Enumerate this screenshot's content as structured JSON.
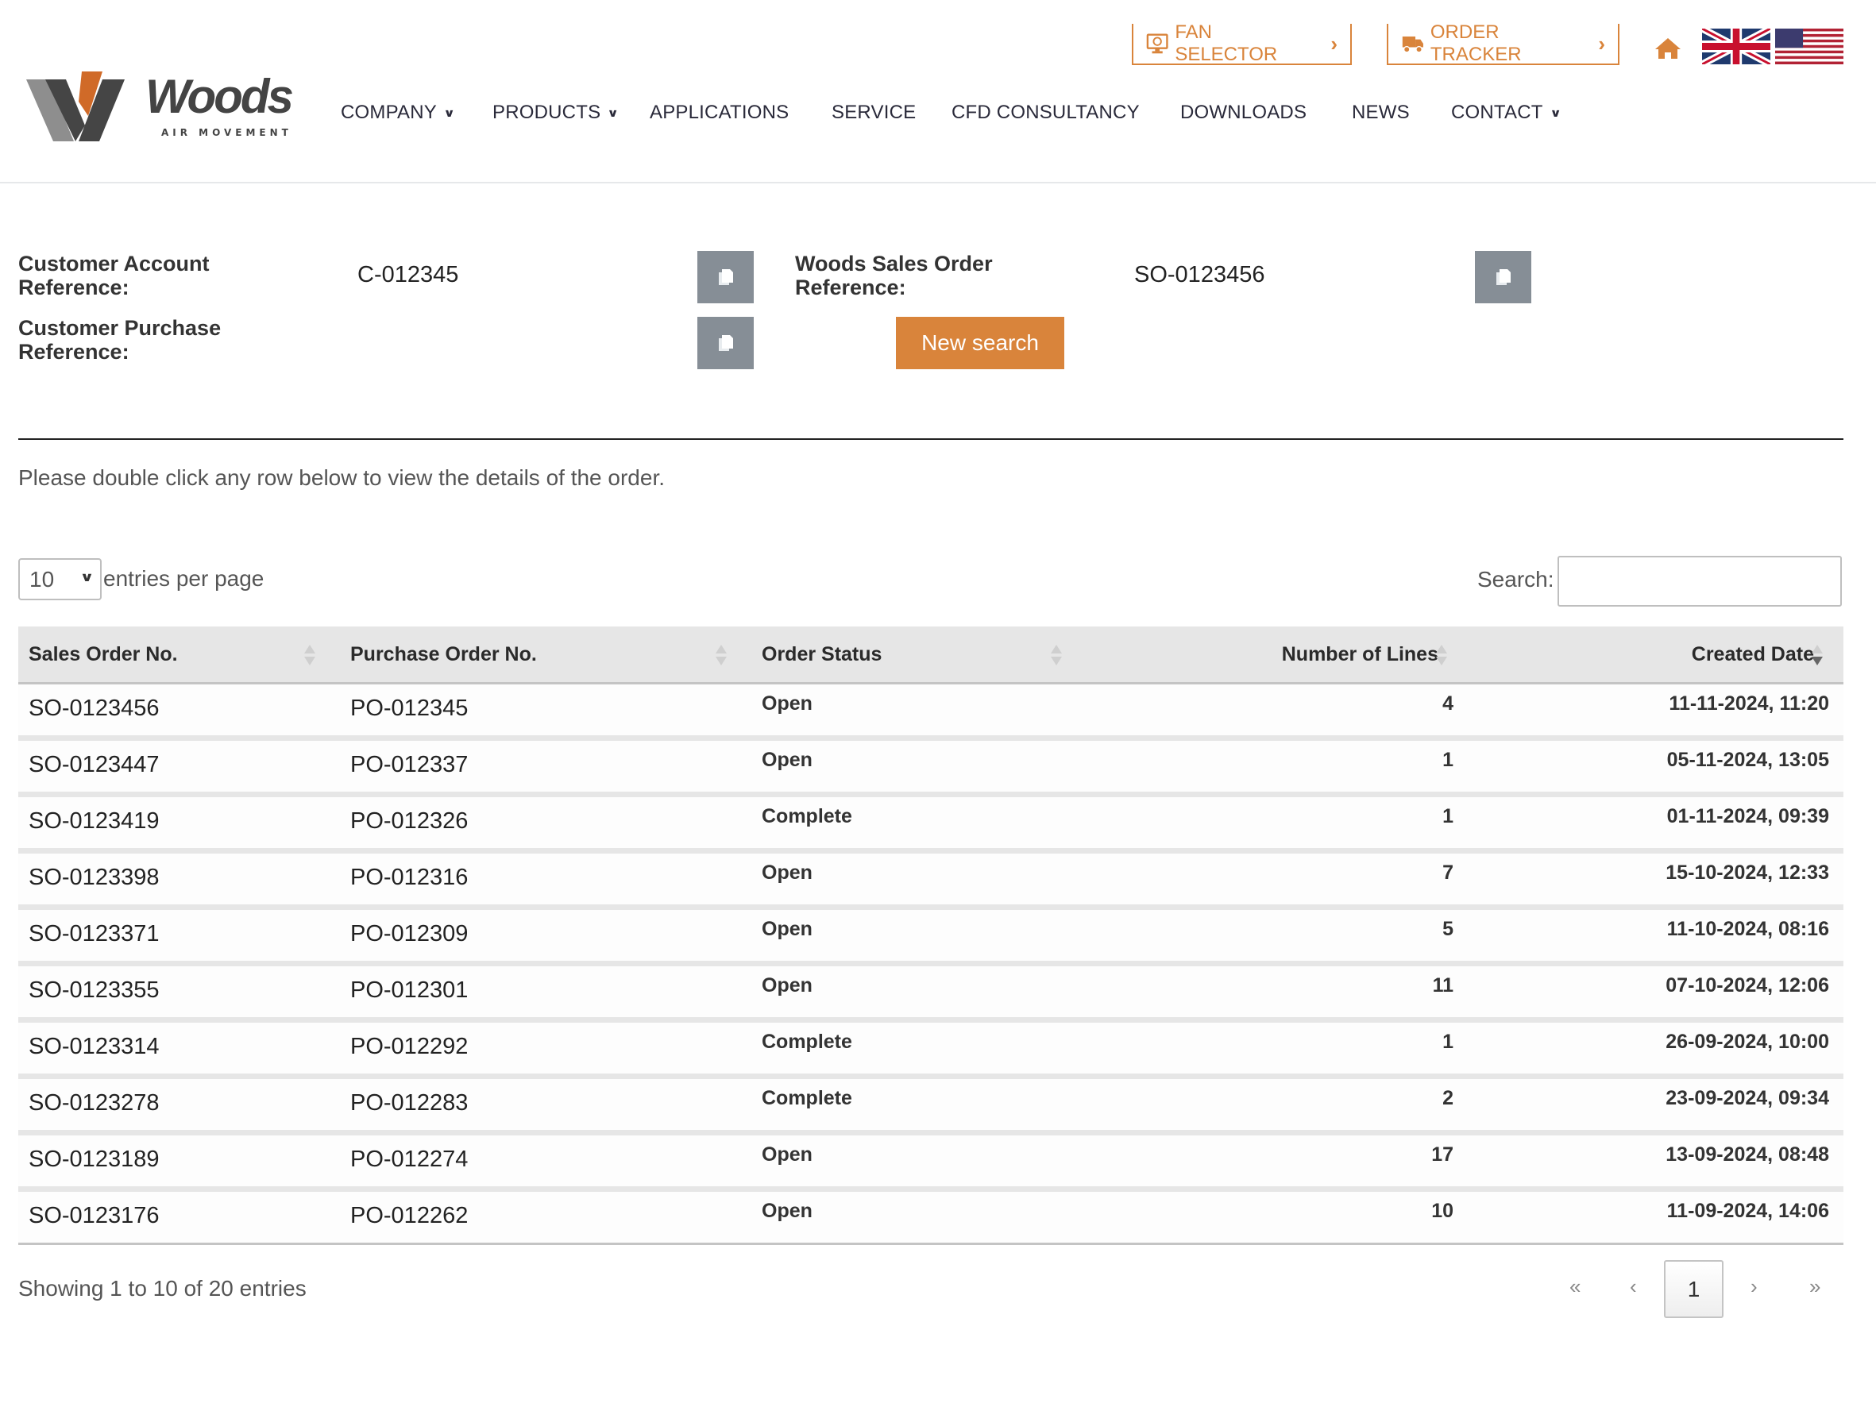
{
  "header": {
    "logo": {
      "name": "Woods",
      "tagline": "AIR MOVEMENT"
    },
    "top_buttons": [
      {
        "label": "FAN SELECTOR",
        "icon": "monitor-fan-icon"
      },
      {
        "label": "ORDER TRACKER",
        "icon": "delivery-truck-icon"
      }
    ],
    "home_icon": "home-icon",
    "languages": [
      "English (UK)",
      "English (US)"
    ],
    "nav": [
      {
        "label": "COMPANY",
        "has_dropdown": true
      },
      {
        "label": "PRODUCTS",
        "has_dropdown": true
      },
      {
        "label": "APPLICATIONS",
        "has_dropdown": false
      },
      {
        "label": "SERVICE",
        "has_dropdown": false
      },
      {
        "label": "CFD CONSULTANCY",
        "has_dropdown": false
      },
      {
        "label": "DOWNLOADS",
        "has_dropdown": false
      },
      {
        "label": "NEWS",
        "has_dropdown": false
      },
      {
        "label": "CONTACT",
        "has_dropdown": true
      }
    ],
    "caret": "⌄",
    "chevron": "›"
  },
  "references": {
    "customer_account": {
      "label_line1": "Customer Account",
      "label_line2": "Reference:",
      "value": "C-012345"
    },
    "customer_purchase": {
      "label_line1": "Customer Purchase",
      "label_line2": "Reference:",
      "value": ""
    },
    "woods_sales_order": {
      "label_line1": "Woods Sales Order",
      "label_line2": "Reference:",
      "value": "SO-0123456"
    },
    "new_search_label": "New search"
  },
  "instruction": "Please double click any row below to view the details of the order.",
  "table_controls": {
    "page_size": "10",
    "entries_label": "entries per page",
    "search_label": "Search:",
    "search_value": ""
  },
  "table": {
    "columns": [
      {
        "label": "Sales Order No.",
        "sort": "none"
      },
      {
        "label": "Purchase Order No.",
        "sort": "none"
      },
      {
        "label": "Order Status",
        "sort": "none"
      },
      {
        "label": "Number of Lines",
        "sort": "none"
      },
      {
        "label": "Created Date",
        "sort": "desc"
      }
    ],
    "rows": [
      {
        "sales_order": "SO-0123456",
        "purchase_order": "PO-012345",
        "status": "Open",
        "lines": "4",
        "created": "11-11-2024, 11:20"
      },
      {
        "sales_order": "SO-0123447",
        "purchase_order": "PO-012337",
        "status": "Open",
        "lines": "1",
        "created": "05-11-2024, 13:05"
      },
      {
        "sales_order": "SO-0123419",
        "purchase_order": "PO-012326",
        "status": "Complete",
        "lines": "1",
        "created": "01-11-2024, 09:39"
      },
      {
        "sales_order": "SO-0123398",
        "purchase_order": "PO-012316",
        "status": "Open",
        "lines": "7",
        "created": "15-10-2024, 12:33"
      },
      {
        "sales_order": "SO-0123371",
        "purchase_order": "PO-012309",
        "status": "Open",
        "lines": "5",
        "created": "11-10-2024, 08:16"
      },
      {
        "sales_order": "SO-0123355",
        "purchase_order": "PO-012301",
        "status": "Open",
        "lines": "11",
        "created": "07-10-2024, 12:06"
      },
      {
        "sales_order": "SO-0123314",
        "purchase_order": "PO-012292",
        "status": "Complete",
        "lines": "1",
        "created": "26-09-2024, 10:00"
      },
      {
        "sales_order": "SO-0123278",
        "purchase_order": "PO-012283",
        "status": "Complete",
        "lines": "2",
        "created": "23-09-2024, 09:34"
      },
      {
        "sales_order": "SO-0123189",
        "purchase_order": "PO-012274",
        "status": "Open",
        "lines": "17",
        "created": "13-09-2024, 08:48"
      },
      {
        "sales_order": "SO-0123176",
        "purchase_order": "PO-012262",
        "status": "Open",
        "lines": "10",
        "created": "11-09-2024, 14:06"
      }
    ]
  },
  "footer": {
    "showing": "Showing 1 to 10 of 20 entries",
    "pager": {
      "first": "«",
      "prev": "‹",
      "current": "1",
      "next": "›",
      "last": "»"
    }
  },
  "colors": {
    "accent": "#d9843b",
    "copy_button": "#868e96",
    "table_header_bg": "#e6e6e6",
    "nav_text": "#2a2a3a"
  }
}
